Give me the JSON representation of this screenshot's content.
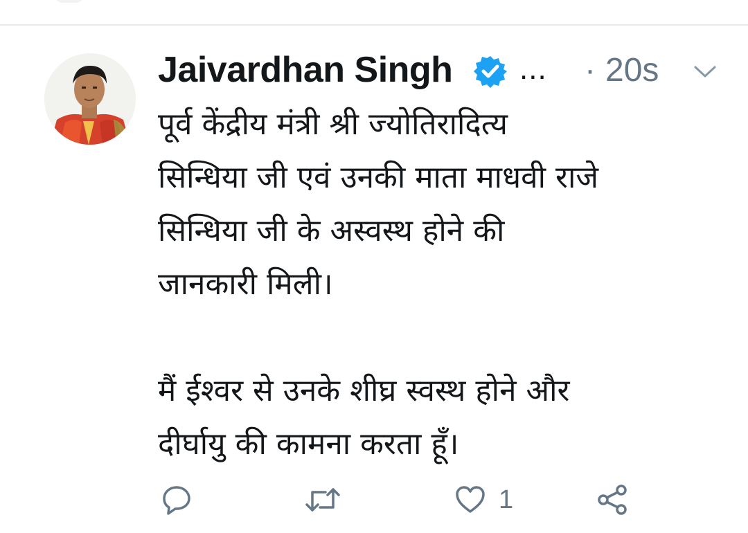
{
  "tweet": {
    "author_name": "Jaivardhan Singh",
    "verified_icon": "verified-badge-icon",
    "ellipsis": "...",
    "separator": "·",
    "timestamp": "20s",
    "menu_icon": "chevron-down-icon",
    "lines": [
      "पूर्व केंद्रीय मंत्री श्री ज्योतिरादित्य",
      "सिन्धिया जी एवं उनकी माता माधवी राजे",
      "सिन्धिया जी के अस्वस्थ होने की",
      "जानकारी मिली।",
      "मैं ईश्वर से उनके शीघ्र स्वस्थ होने और",
      "दीर्घायु की कामना करता हूँ।"
    ],
    "actions": {
      "reply_icon": "reply-icon",
      "retweet_icon": "retweet-icon",
      "like_icon": "heart-icon",
      "like_count": "1",
      "share_icon": "share-icon"
    }
  },
  "colors": {
    "text_primary": "#14171a",
    "text_secondary": "#657786",
    "verified_blue": "#1da1f2",
    "divider": "#e6ecf0"
  }
}
